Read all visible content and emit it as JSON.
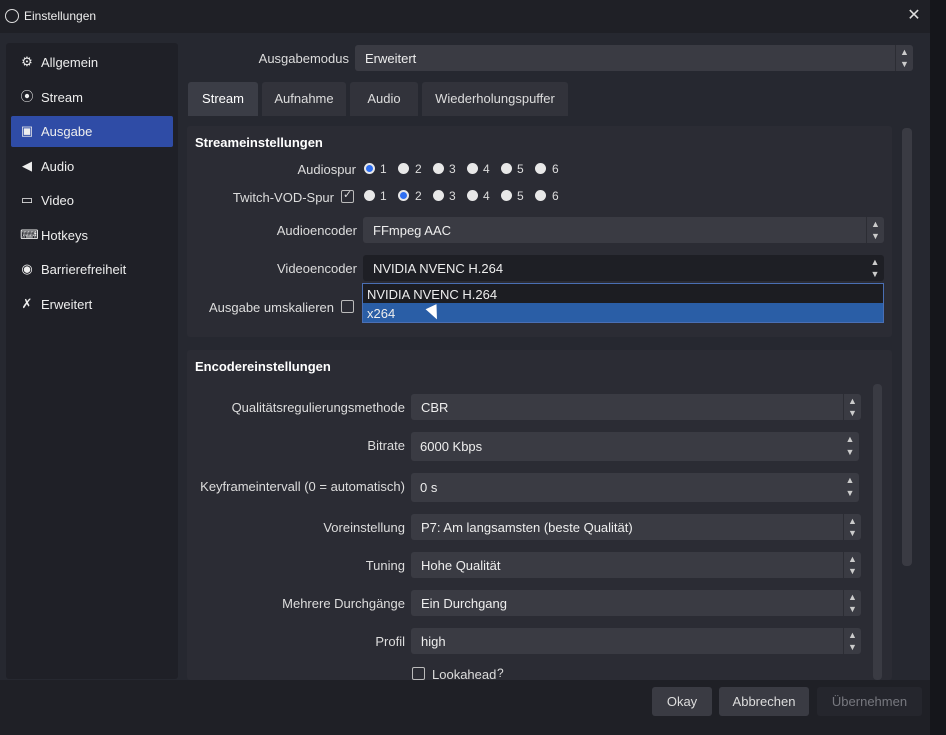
{
  "window": {
    "title": "Einstellungen"
  },
  "sidebar": {
    "items": [
      {
        "label": "Allgemein",
        "icon": "gear-icon"
      },
      {
        "label": "Stream",
        "icon": "antenna-icon"
      },
      {
        "label": "Ausgabe",
        "icon": "output-icon"
      },
      {
        "label": "Audio",
        "icon": "speaker-icon"
      },
      {
        "label": "Video",
        "icon": "monitor-icon"
      },
      {
        "label": "Hotkeys",
        "icon": "keyboard-icon"
      },
      {
        "label": "Barrierefreiheit",
        "icon": "accessibility-icon"
      },
      {
        "label": "Erweitert",
        "icon": "tools-icon"
      }
    ],
    "active": "Ausgabe"
  },
  "output_mode": {
    "label": "Ausgabemodus",
    "value": "Erweitert"
  },
  "tabs": [
    "Stream",
    "Aufnahme",
    "Audio",
    "Wiederholungspuffer"
  ],
  "stream_settings": {
    "title": "Streameinstellungen",
    "audio_track_label": "Audiospur",
    "vod_track_label": "Twitch-VOD-Spur",
    "track_numbers": [
      "1",
      "2",
      "3",
      "4",
      "5",
      "6"
    ],
    "audio_encoder_label": "Audioencoder",
    "audio_encoder_value": "FFmpeg AAC",
    "video_encoder_label": "Videoencoder",
    "video_encoder_value": "NVIDIA NVENC H.264",
    "rescale_label": "Ausgabe umskalieren",
    "dropdown_options": [
      "NVIDIA NVENC H.264",
      "x264"
    ]
  },
  "encoder_settings": {
    "title": "Encodereinstellungen",
    "rate_control_label": "Qualitätsregulierungsmethode",
    "rate_control_value": "CBR",
    "bitrate_label": "Bitrate",
    "bitrate_value": "6000 Kbps",
    "keyframe_label": "Keyframeintervall (0 = automatisch)",
    "keyframe_value": "0 s",
    "preset_label": "Voreinstellung",
    "preset_value": "P7: Am langsamsten (beste Qualität)",
    "tuning_label": "Tuning",
    "tuning_value": "Hohe Qualität",
    "multipass_label": "Mehrere Durchgänge",
    "multipass_value": "Ein Durchgang",
    "profile_label": "Profil",
    "profile_value": "high",
    "lookahead_label": "Lookahead"
  },
  "buttons": {
    "ok": "Okay",
    "cancel": "Abbrechen",
    "apply": "Übernehmen"
  },
  "colors": {
    "accent": "#2f4ca6",
    "selection": "#2a5ea6",
    "radio_on": "#2e6ef0"
  }
}
